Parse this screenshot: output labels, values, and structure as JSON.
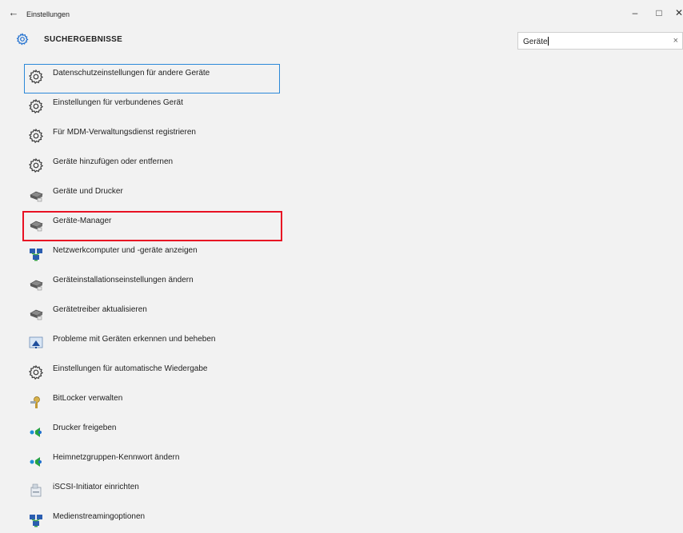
{
  "window": {
    "title": "Einstellungen",
    "back_icon": "←",
    "minimize_icon": "–",
    "maximize_icon": "□",
    "close_icon": "✕"
  },
  "header": {
    "title": "SUCHERGEBNISSE",
    "icon": "gear-icon",
    "accent": "#1f6fcf"
  },
  "search": {
    "value": "Geräte",
    "clear_icon": "×"
  },
  "results": [
    {
      "label": "Datenschutzeinstellungen für andere Geräte",
      "icon": "gear-icon"
    },
    {
      "label": "Einstellungen für verbundenes Gerät",
      "icon": "gear-icon"
    },
    {
      "label": "Für MDM-Verwaltungsdienst registrieren",
      "icon": "gear-icon"
    },
    {
      "label": "Geräte hinzufügen oder entfernen",
      "icon": "gear-icon"
    },
    {
      "label": "Geräte und Drucker",
      "icon": "printer-icon"
    },
    {
      "label": "Geräte-Manager",
      "icon": "printer-icon"
    },
    {
      "label": "Netzwerkcomputer und -geräte anzeigen",
      "icon": "network-icon"
    },
    {
      "label": "Geräteinstallationseinstellungen ändern",
      "icon": "printer-icon"
    },
    {
      "label": "Gerätetreiber aktualisieren",
      "icon": "printer-icon"
    },
    {
      "label": "Probleme mit Geräten erkennen und beheben",
      "icon": "troubleshoot-icon"
    },
    {
      "label": "Einstellungen für automatische Wiedergabe",
      "icon": "gear-icon"
    },
    {
      "label": "BitLocker verwalten",
      "icon": "key-icon"
    },
    {
      "label": "Drucker freigeben",
      "icon": "homegroup-icon"
    },
    {
      "label": "Heimnetzgruppen-Kennwort ändern",
      "icon": "homegroup-icon"
    },
    {
      "label": "iSCSI-Initiator einrichten",
      "icon": "iscsi-icon"
    },
    {
      "label": "Medienstreamingoptionen",
      "icon": "network-icon"
    }
  ],
  "colors": {
    "background": "#f2f2f2",
    "focus_border": "#2b88d8",
    "highlight_border": "#e81123"
  }
}
